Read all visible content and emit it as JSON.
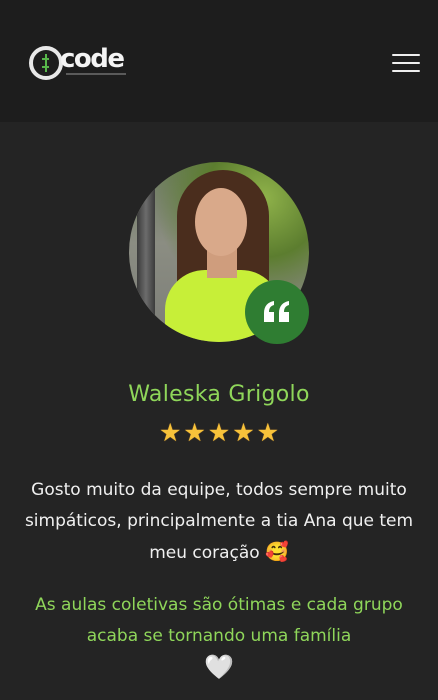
{
  "header": {
    "logo_text": "code",
    "menu_icon": "hamburger-icon"
  },
  "testimonial": {
    "name": "Waleska Grigolo",
    "stars": [
      "★",
      "★",
      "★",
      "★",
      "★"
    ],
    "rating": 5,
    "quote_icon": "quote-icon",
    "text": "Gosto muito da equipe, todos sempre muito simpáticos, principalmente a tia Ana que tem meu coração",
    "text_emoji": "🥰",
    "highlight": "As aulas coletivas são ótimas e cada grupo acaba se tornando uma família",
    "highlight_emoji": "🤍"
  },
  "colors": {
    "accent": "#8fd65a",
    "badge": "#2f7d32",
    "background": "#242424",
    "header": "#1d1d1d",
    "star": "#f7c23a"
  }
}
